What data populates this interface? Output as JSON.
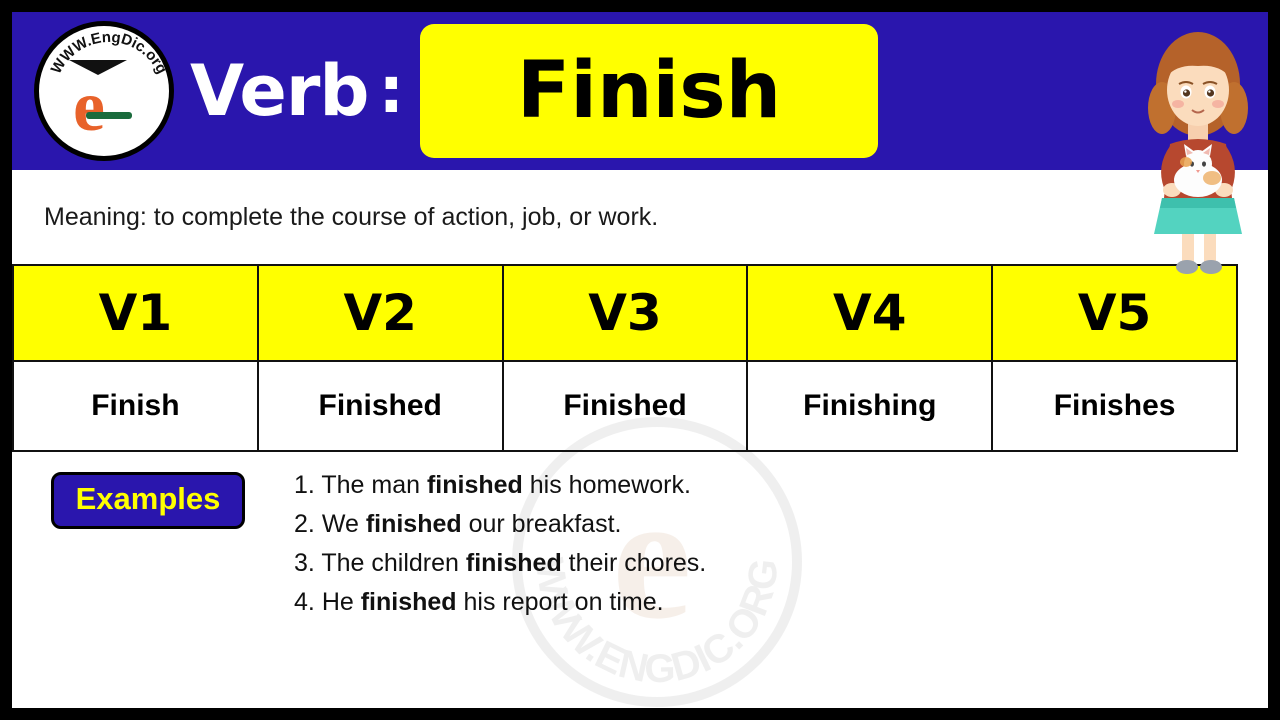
{
  "brand": {
    "logo_text_top": "WWW.",
    "logo_text_mid": "EngDic",
    "logo_text_end": ".org",
    "logo_full": "WWW.EngDic.org",
    "logo_letter": "e",
    "watermark_text": "WWW.ENGDIC.ORG"
  },
  "header": {
    "label": "Verb",
    "colon": ":",
    "word": "Finish"
  },
  "meaning": {
    "text": "Meaning: to complete the course of action, job, or work."
  },
  "table": {
    "headers": [
      "V1",
      "V2",
      "V3",
      "V4",
      "V5"
    ],
    "forms": [
      "Finish",
      "Finished",
      "Finished",
      "Finishing",
      "Finishes"
    ]
  },
  "examples": {
    "badge": "Examples",
    "items": [
      {
        "num": "1.",
        "pre": "The man ",
        "bold": "finished",
        "post": " his homework."
      },
      {
        "num": "2.",
        "pre": "We ",
        "bold": "finished",
        "post": " our breakfast."
      },
      {
        "num": "3.",
        "pre": "The children ",
        "bold": "finished",
        "post": " their chores."
      },
      {
        "num": "4.",
        "pre": "He ",
        "bold": "finished",
        "post": " his report on time."
      }
    ]
  },
  "colors": {
    "brand_blue": "#2a16ad",
    "accent_yellow": "#ffff00",
    "border_black": "#000000"
  }
}
